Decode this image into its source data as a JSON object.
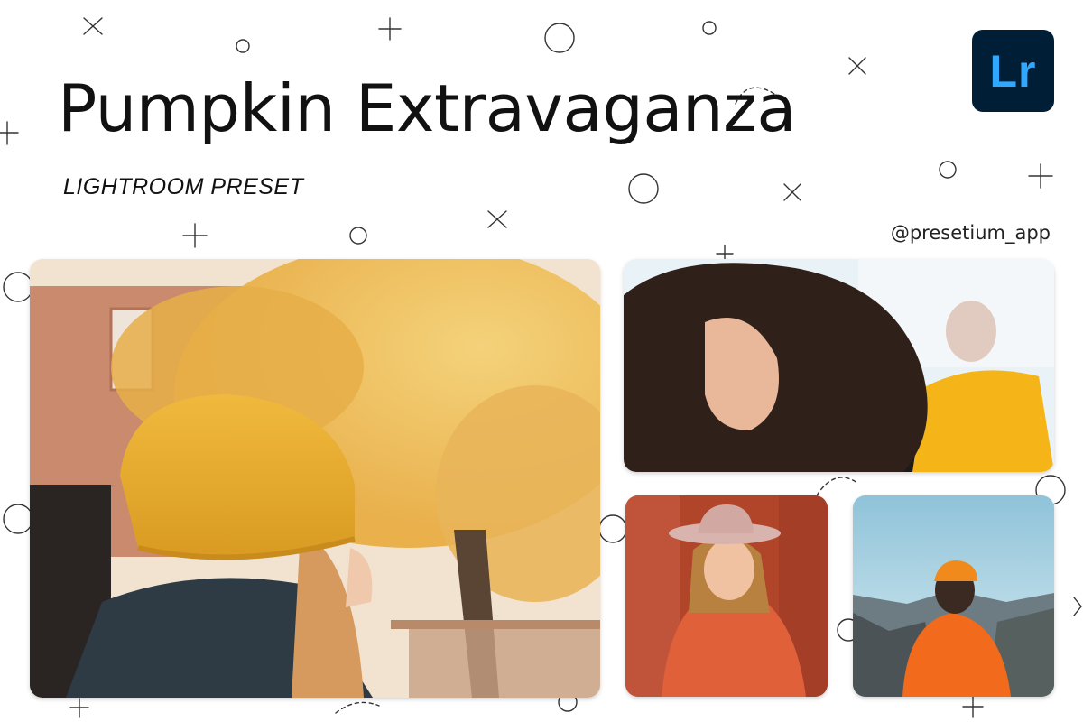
{
  "header": {
    "title": "Pumpkin Extravaganza",
    "subtitle": "LIGHTROOM PRESET",
    "handle": "@presetium_app"
  },
  "logo": {
    "text": "Lr",
    "icon": "lightroom-logo-icon",
    "background": "#001e36",
    "color": "#31a8ff"
  },
  "colors": {
    "background": "#ffffff",
    "text": "#111111",
    "accent_orange": "#e8a634"
  }
}
